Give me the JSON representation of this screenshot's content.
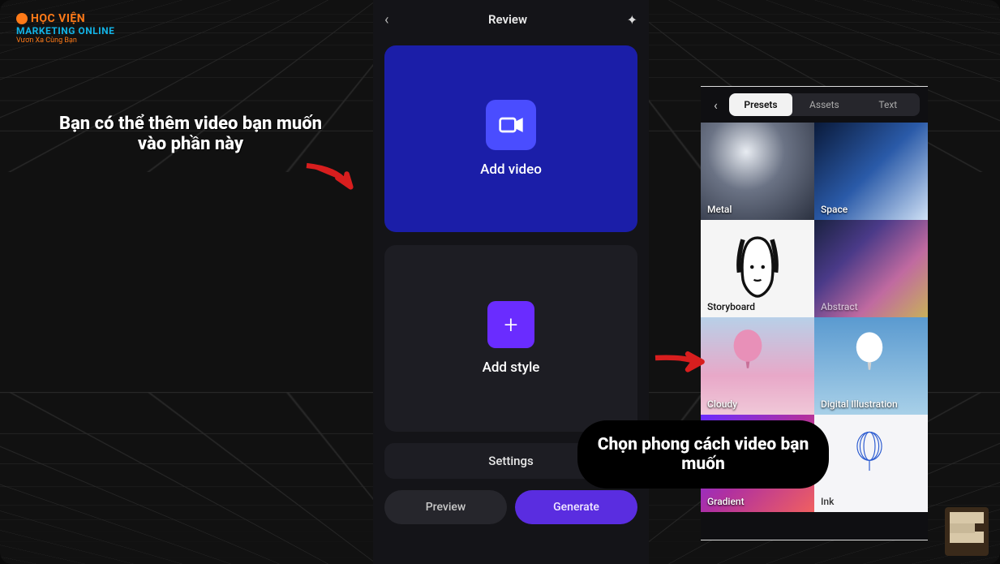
{
  "logo": {
    "line1": "HỌC VIỆN",
    "line2": "MARKETING ONLINE",
    "line3": "Vươn Xa Cùng Bạn"
  },
  "annotation1": "Bạn có thể thêm video bạn muốn vào phần này",
  "annotation2": "Chọn phong cách video bạn muốn",
  "main": {
    "title": "Review",
    "add_video": "Add video",
    "add_style": "Add style",
    "settings": "Settings",
    "preview": "Preview",
    "generate": "Generate"
  },
  "side": {
    "tabs": {
      "presets": "Presets",
      "assets": "Assets",
      "text": "Text"
    },
    "tiles": {
      "metal": "Metal",
      "space": "Space",
      "storyboard": "Storyboard",
      "abstract": "Abstract",
      "cloudy": "Cloudy",
      "digital": "Digital Illustration",
      "gradient": "Gradient",
      "ink": "Ink"
    }
  }
}
